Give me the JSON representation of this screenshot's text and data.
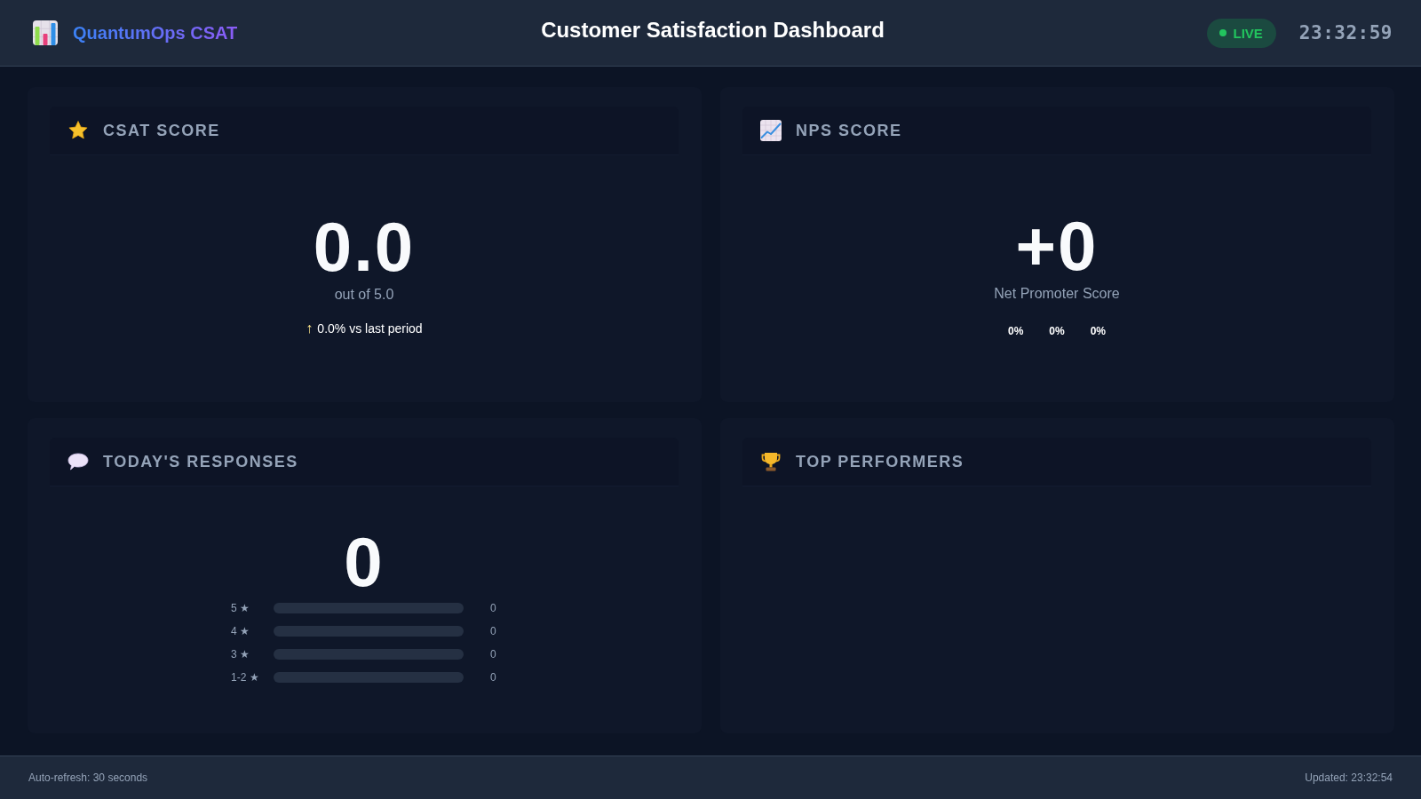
{
  "header": {
    "brand": "QuantumOps CSAT",
    "title": "Customer Satisfaction Dashboard",
    "live_label": "LIVE",
    "clock": "23:32:59"
  },
  "cards": [
    {
      "kind": "csat",
      "title": "CSAT SCORE",
      "score": "0.0",
      "subtitle": "out of 5.0",
      "trend": {
        "arrow": "↑",
        "text": "0.0% vs last period"
      }
    },
    {
      "kind": "nps",
      "title": "NPS SCORE",
      "score": "+0",
      "subtitle": "Net Promoter Score",
      "breakdown": [
        "0%",
        "0%",
        "0%"
      ]
    },
    {
      "kind": "responses",
      "title": "TODAY'S RESPONSES",
      "score": "0",
      "distribution": [
        {
          "label": "5 ★",
          "level": 0,
          "count": "0"
        },
        {
          "label": "4 ★",
          "level": 0,
          "count": "0"
        },
        {
          "label": "3 ★",
          "level": 0,
          "count": "0"
        },
        {
          "label": "1-2 ★",
          "level": 0,
          "count": "0"
        }
      ]
    },
    {
      "kind": "performers",
      "title": "TOP PERFORMERS"
    }
  ],
  "footer": {
    "refresh": "Auto-refresh: 30 seconds",
    "updated": "Updated: 23:32:54"
  }
}
